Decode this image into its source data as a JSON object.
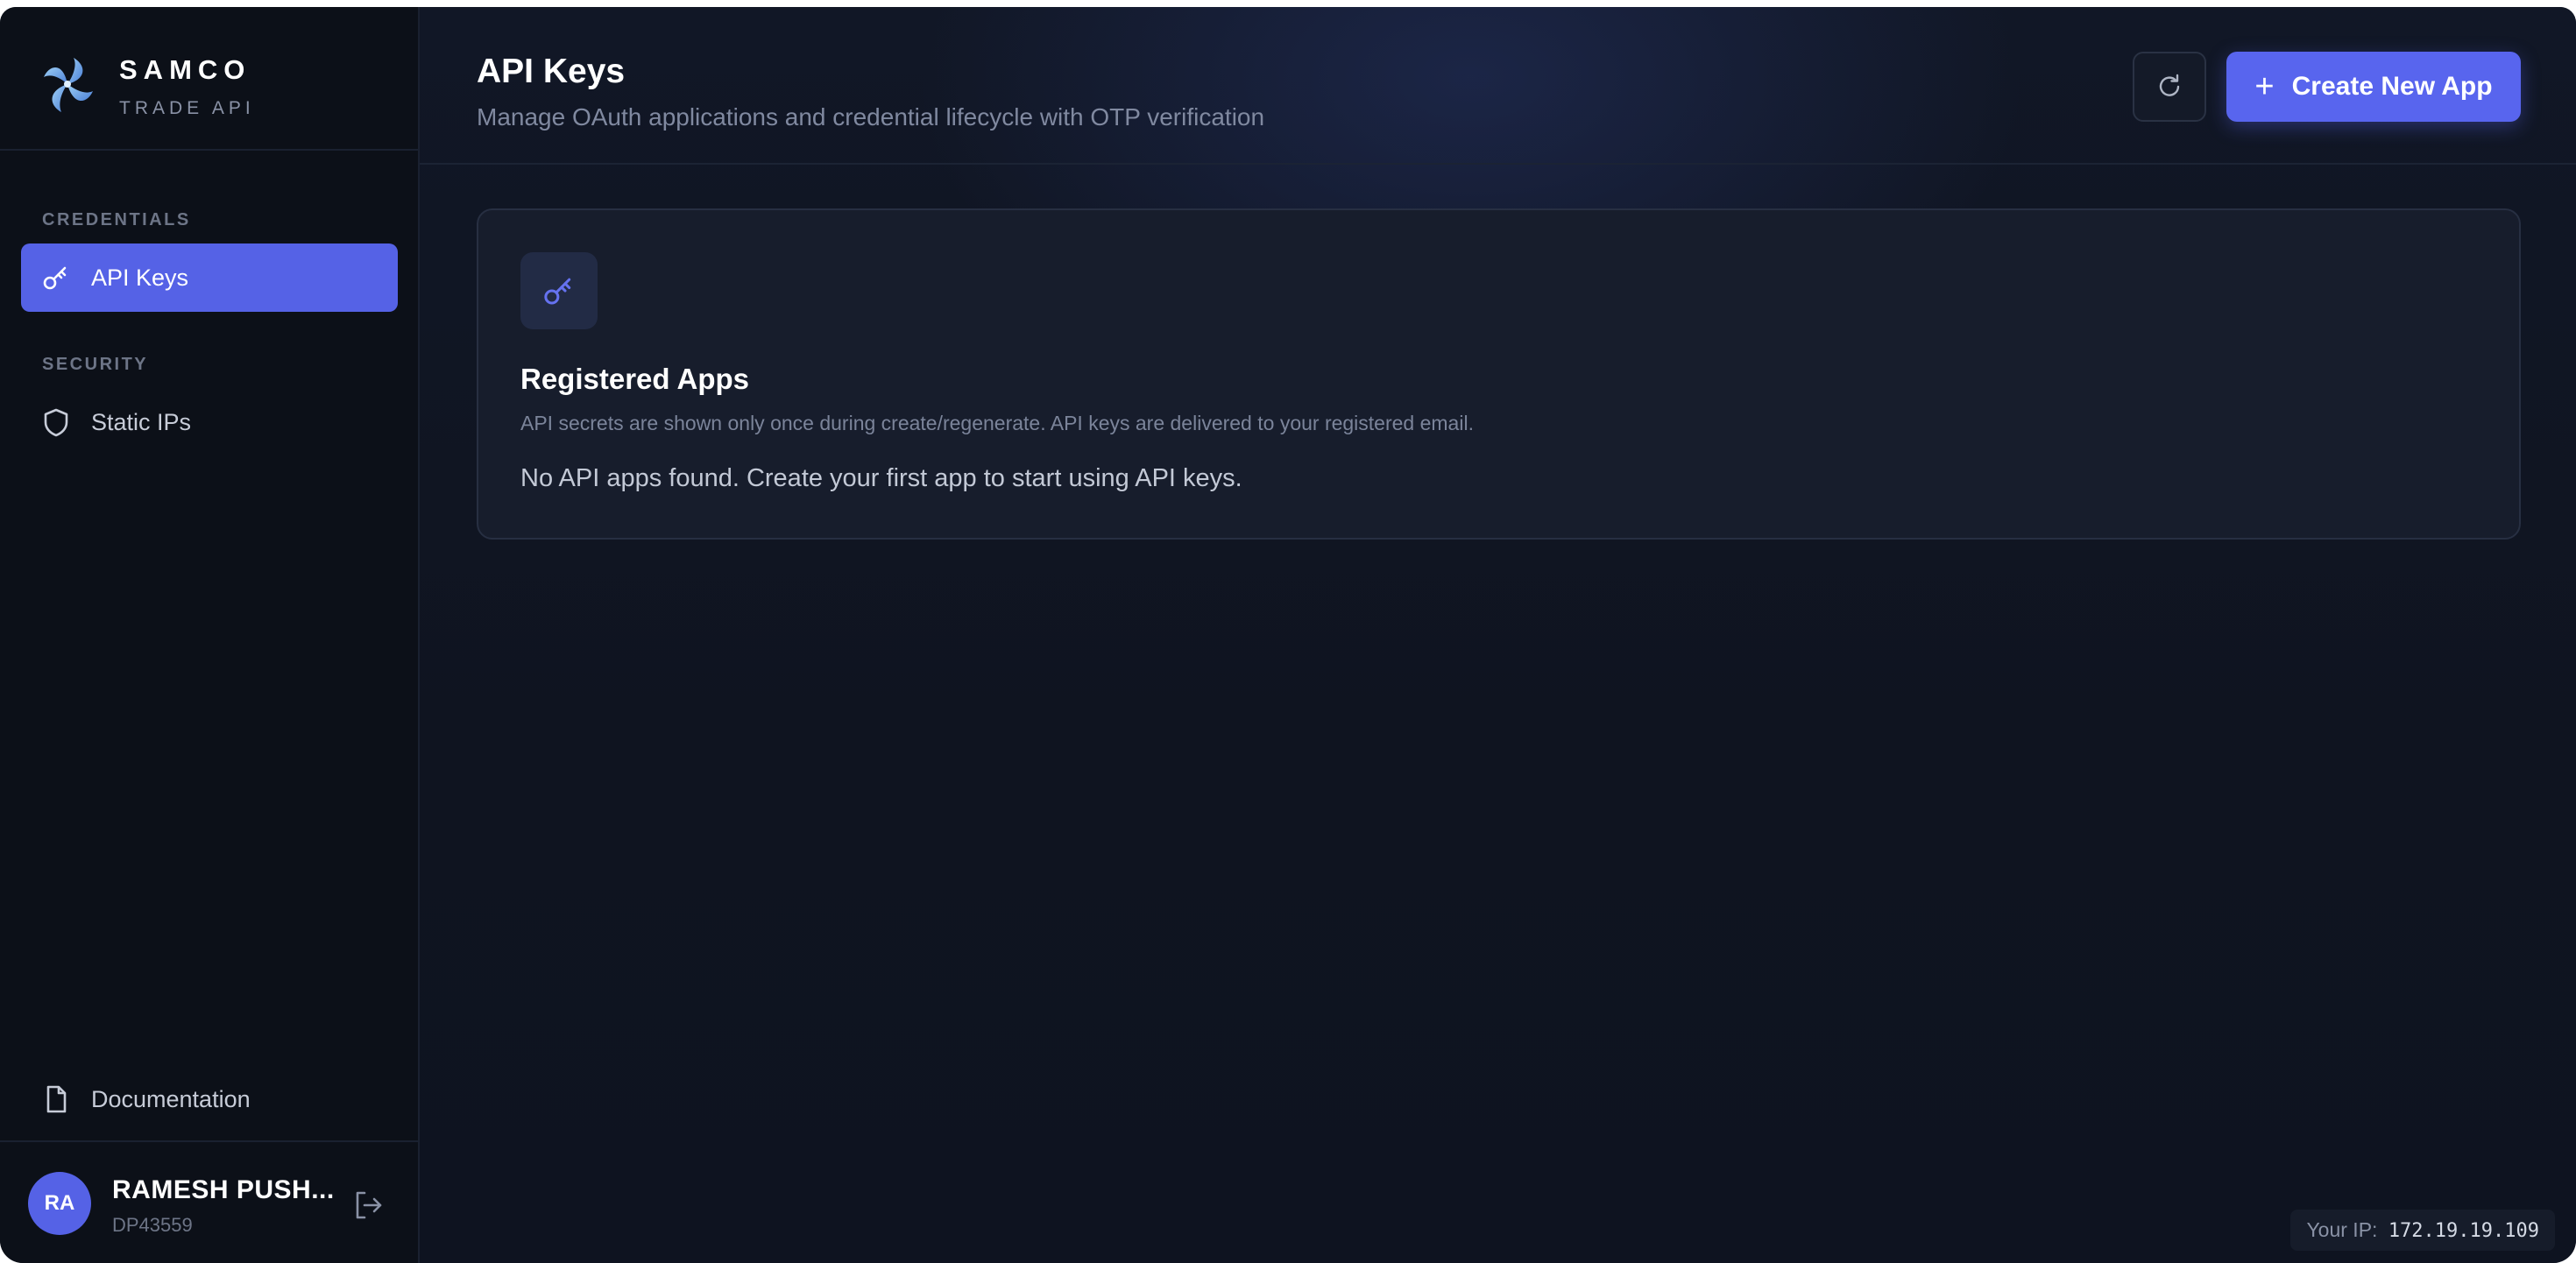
{
  "brand": {
    "name": "SAMCO",
    "subtitle": "TRADE API",
    "logo_icon": "pinwheel-logo"
  },
  "sidebar": {
    "sections": [
      {
        "title": "CREDENTIALS",
        "items": [
          {
            "label": "API Keys",
            "icon": "key-icon",
            "active": true
          }
        ]
      },
      {
        "title": "SECURITY",
        "items": [
          {
            "label": "Static IPs",
            "icon": "shield-icon",
            "active": false
          }
        ]
      }
    ],
    "footer_link": {
      "label": "Documentation",
      "icon": "document-icon"
    },
    "user": {
      "initials": "RA",
      "name": "RAMESH PUSH...",
      "id": "DP43559",
      "logout_icon": "logout-icon"
    }
  },
  "header": {
    "title": "API Keys",
    "subtitle": "Manage OAuth applications and credential lifecycle with OTP verification",
    "refresh_icon": "refresh-icon",
    "create_button": {
      "icon": "plus-icon",
      "label": "Create New App"
    }
  },
  "card": {
    "icon": "key-icon",
    "title": "Registered Apps",
    "description": "API secrets are shown only once during create/regenerate. API keys are delivered to your registered email.",
    "empty_message": "No API apps found. Create your first app to start using API keys."
  },
  "ip_badge": {
    "label": "Your IP:",
    "value": "172.19.19.109"
  },
  "colors": {
    "accent": "#5562e6",
    "background": "#0f1420",
    "sidebar": "#0c1018",
    "card": "#171d2c"
  }
}
